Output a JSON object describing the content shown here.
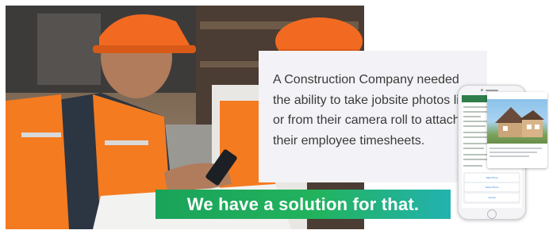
{
  "headline": "A Construction Company needed the ability to take jobsite photos live or from their camera roll to attach to their employee timesheets.",
  "banner": "We have a solution for that.",
  "phone": {
    "sheet_options": [
      "Take Photo",
      "Select Photo",
      "Cancel"
    ]
  },
  "colors": {
    "banner_start": "#1aa35a",
    "banner_end": "#23b2b0",
    "vest": "#f47b20",
    "hardhat": "#f26a21",
    "card_bg": "#f3f3f7"
  },
  "icons": [
    "phone-mockup",
    "house-photo",
    "construction-worker-photo"
  ]
}
